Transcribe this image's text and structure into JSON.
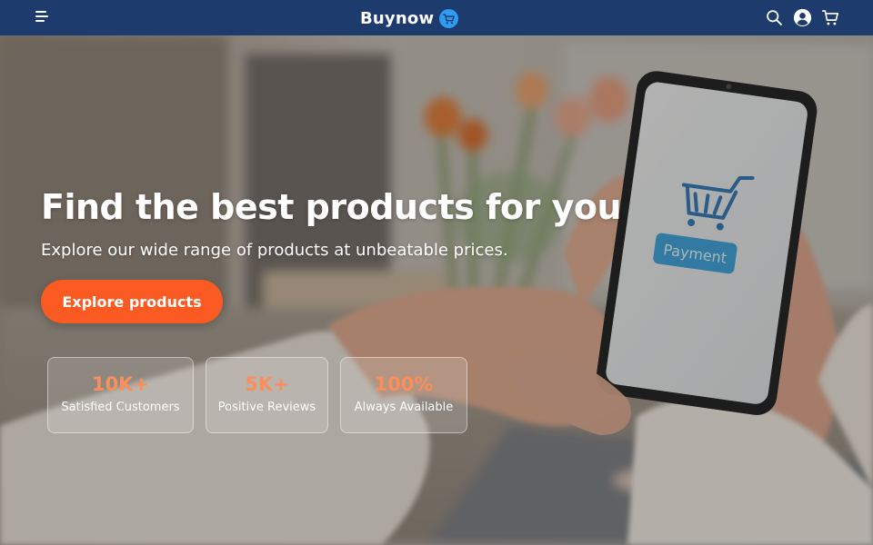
{
  "header": {
    "brand": "Buynow",
    "icons": [
      "menu-icon",
      "cart-icon",
      "search-icon",
      "user-icon",
      "cart-icon"
    ]
  },
  "hero": {
    "title": "Find the best products for you",
    "subtitle": "Explore our wide range of products at unbeatable prices.",
    "cta_label": "Explore products",
    "image_text": "Payment",
    "stats": [
      {
        "value": "10K+",
        "label": "Satisfied Customers"
      },
      {
        "value": "5K+",
        "label": "Positive Reviews"
      },
      {
        "value": "100%",
        "label": "Always Available"
      }
    ]
  },
  "colors": {
    "navbar": "#1d3b6c",
    "accent": "#fb5a22",
    "stat_value": "#f98f5a"
  }
}
